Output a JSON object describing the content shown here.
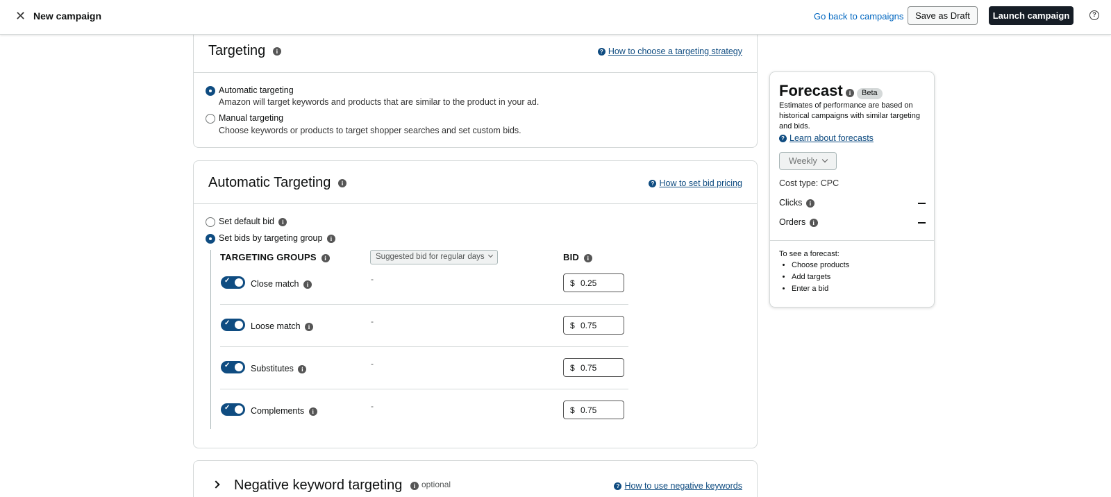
{
  "header": {
    "title": "New campaign",
    "back_link": "Go back to campaigns",
    "save_draft": "Save as Draft",
    "launch": "Launch campaign",
    "help_icon": "question-circle-icon",
    "close_icon": "close-icon"
  },
  "targeting": {
    "title": "Targeting",
    "help_link": "How to choose a targeting strategy",
    "options": [
      {
        "label": "Automatic targeting",
        "description": "Amazon will target keywords and products that are similar to the product in your ad.",
        "selected": true
      },
      {
        "label": "Manual targeting",
        "description": "Choose keywords or products to target shopper searches and set custom bids.",
        "selected": false
      }
    ]
  },
  "automatic": {
    "title": "Automatic Targeting",
    "help_link": "How to set bid pricing",
    "bid_options": [
      {
        "label": "Set default bid",
        "selected": false
      },
      {
        "label": "Set bids by targeting group",
        "selected": true
      }
    ],
    "groups_header": "TARGETING GROUPS",
    "suggested_select": "Suggested bid for regular days",
    "bid_header": "BID",
    "groups": [
      {
        "label": "Close match",
        "suggested": "-",
        "currency": "$",
        "bid": "0.25",
        "enabled": true
      },
      {
        "label": "Loose match",
        "suggested": "-",
        "currency": "$",
        "bid": "0.75",
        "enabled": true
      },
      {
        "label": "Substitutes",
        "suggested": "-",
        "currency": "$",
        "bid": "0.75",
        "enabled": true
      },
      {
        "label": "Complements",
        "suggested": "-",
        "currency": "$",
        "bid": "0.75",
        "enabled": true
      }
    ]
  },
  "negative": {
    "title": "Negative keyword targeting",
    "optional": "optional",
    "help_link": "How to use negative keywords"
  },
  "forecast": {
    "title": "Forecast",
    "badge": "Beta",
    "description": "Estimates of performance are based on historical campaigns with similar targeting and bids.",
    "learn_link": "Learn about forecasts",
    "period": "Weekly",
    "cost_type": "Cost type: CPC",
    "metrics": [
      {
        "label": "Clicks"
      },
      {
        "label": "Orders"
      }
    ],
    "hint_title": "To see a forecast:",
    "hint_items": [
      "Choose products",
      "Add targets",
      "Enter a bid"
    ]
  },
  "colors": {
    "accent": "#0f4c81",
    "launch_bg": "#161d26",
    "link": "#0066c0"
  }
}
